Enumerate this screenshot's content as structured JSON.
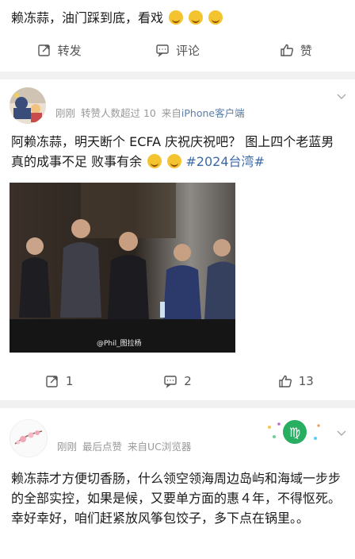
{
  "top_post": {
    "text": "赖冻蒜，油门踩到底，看戏",
    "actions": {
      "repost": "转发",
      "comment": "评论",
      "like": "赞"
    }
  },
  "post1": {
    "meta_time": "刚刚",
    "meta_reposts": "转赞人数超过 10",
    "meta_from": "来自",
    "meta_source": "iPhone客户端",
    "text_a": "阿赖冻蒜，明天断个 ECFA 庆祝庆祝吧？ 图上四个老蓝男真的成事不足 败事有余",
    "hashtag": "#2024台湾#",
    "image_watermark": "@Phil_图拉杨",
    "actions": {
      "repost_count": "1",
      "comment_count": "2",
      "like_count": "13"
    }
  },
  "post2": {
    "meta_time": "刚刚",
    "meta_like": "最后点赞",
    "meta_from": "来自",
    "meta_source": "UC浏览器",
    "text": "赖冻蒜才方便切香肠，什么领空领海周边岛屿和海域一步步的全部实控，如果是候，又要单方面的惠４年，不得怄死。幸好幸好，咱们赶紧放风筝包饺子，多下点在锅里。。"
  },
  "colors": {
    "link": "#3d6aa8",
    "meta": "#999999",
    "separator": "#f1f1f1"
  },
  "icons": [
    "repost-icon",
    "comment-icon",
    "like-icon",
    "chevron-down-icon",
    "laugh-emoji-icon",
    "fear-emoji-icon"
  ]
}
